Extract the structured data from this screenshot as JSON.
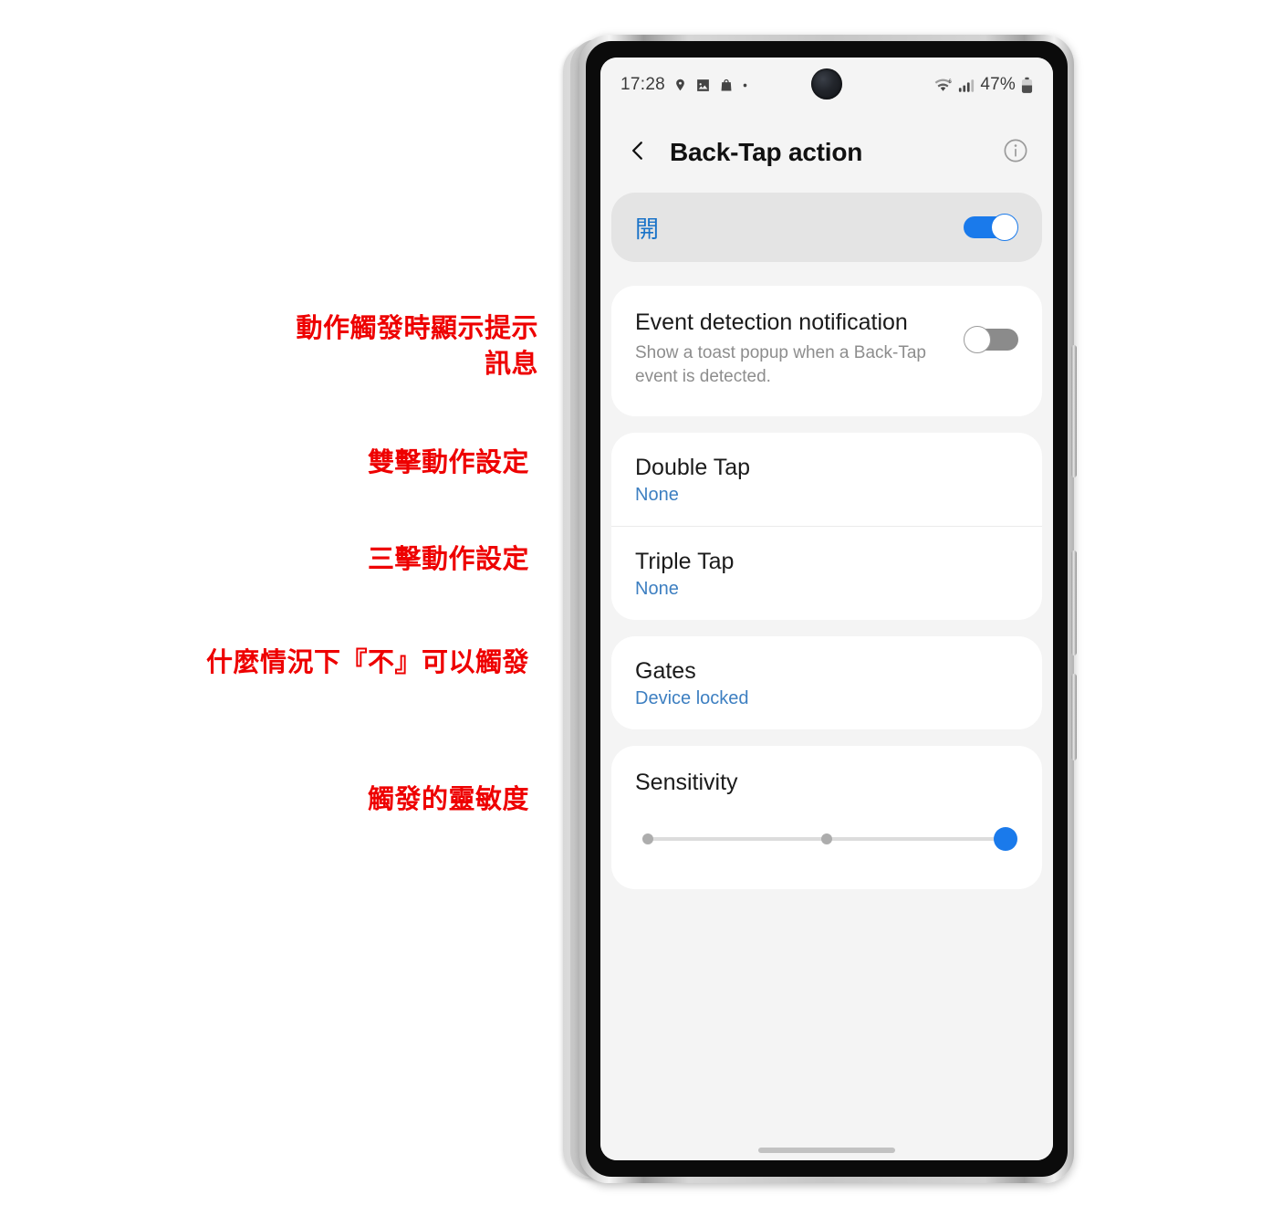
{
  "annotations": [
    {
      "name": "annotation-event-notification",
      "text": "動作觸發時顯示提示\n訊息"
    },
    {
      "name": "annotation-double-tap",
      "text": "雙擊動作設定"
    },
    {
      "name": "annotation-triple-tap",
      "text": "三擊動作設定"
    },
    {
      "name": "annotation-gates",
      "text": "什麼情況下『不』可以觸發"
    },
    {
      "name": "annotation-sensitivity",
      "text": "觸發的靈敏度"
    }
  ],
  "status_bar": {
    "time": "17:28",
    "battery_percent": "47%",
    "left_icons": [
      "location-pin-icon",
      "image-icon",
      "shopping-bag-icon",
      "dot-icon"
    ],
    "right_icons": [
      "wifi-6-icon",
      "cellular-signal-icon",
      "battery-icon"
    ]
  },
  "app_bar": {
    "back_icon": "chevron-left-icon",
    "title": "Back-Tap action",
    "info_icon": "info-circle-icon"
  },
  "master_switch": {
    "label": "開",
    "state": "on"
  },
  "notification_setting": {
    "title": "Event detection notification",
    "description": "Show a toast popup when a Back-Tap event is detected.",
    "state": "off"
  },
  "tap_settings": [
    {
      "title": "Double Tap",
      "value": "None"
    },
    {
      "title": "Triple Tap",
      "value": "None"
    }
  ],
  "gates_setting": {
    "title": "Gates",
    "value": "Device locked"
  },
  "sensitivity": {
    "title": "Sensitivity",
    "ticks": 3,
    "value_index": 2,
    "thumb_percent": "100%"
  },
  "colors": {
    "accent_blue": "#1a7aeb",
    "value_blue": "#3d7fc1",
    "annotation_red": "#ee0000",
    "screen_bg": "#f4f4f4",
    "card_bg": "#ffffff",
    "master_card_bg": "#e4e4e4",
    "switch_off": "#8b8b8b"
  }
}
